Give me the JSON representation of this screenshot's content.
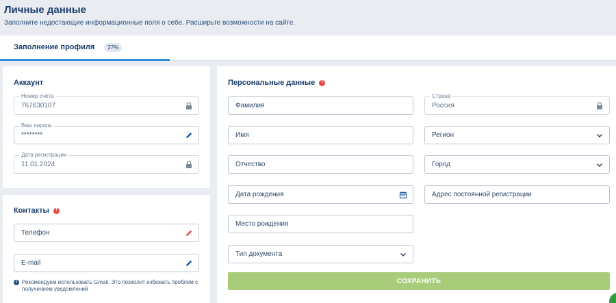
{
  "header": {
    "title": "Личные данные",
    "subtitle": "Заполните недостающие информационные поля о себе. Расширьте возможности на сайте."
  },
  "tabs": [
    {
      "label": "Заполнение профиля",
      "badge": "27%",
      "progress_percent": 27
    }
  ],
  "account": {
    "title": "Аккаунт",
    "fields": [
      {
        "label": "Номер счёта",
        "value": "767630107",
        "icon": "lock-icon"
      },
      {
        "label": "Ваш пароль",
        "value": "********",
        "icon": "pencil-icon"
      },
      {
        "label": "Дата регистрации",
        "value": "11.01.2024",
        "icon": "lock-icon"
      }
    ]
  },
  "contacts": {
    "title": "Контакты",
    "phone_placeholder": "Телефон",
    "email_placeholder": "E-mail",
    "hint": "Рекомендуем использовать Gmail. Это позволит избежать проблем с получением уведомлений"
  },
  "personal": {
    "title": "Персональные данные",
    "last_name": "Фамилия",
    "first_name": "Имя",
    "patronymic": "Отчество",
    "birth_date": "Дата рождения",
    "birth_place": "Место рождения",
    "document_type": "Тип документа",
    "country_label": "Страна",
    "country_value": "Россия",
    "region": "Регион",
    "city": "Город",
    "address": "Адрес постоянной регистрации"
  },
  "actions": {
    "save_label": "СОХРАНИТЬ"
  },
  "colors": {
    "accent": "#2f8fe0",
    "save_button": "#a8cc7a",
    "required_dot": "#e84a4a",
    "pencil_red": "#e84a4a",
    "pencil_blue": "#1f5aa6"
  }
}
